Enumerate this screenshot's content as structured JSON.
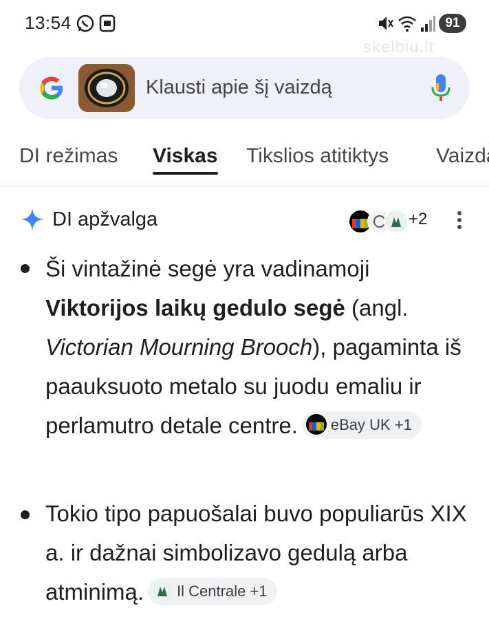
{
  "status_bar": {
    "time": "13:54",
    "battery": "91",
    "icons": [
      "whatsapp-icon",
      "screenshot-icon",
      "mute-icon",
      "wifi-icon",
      "signal-icon"
    ]
  },
  "watermark": "skelbiu.lt",
  "search": {
    "placeholder": "Klausti apie šį vaizdą",
    "icons": [
      "google-logo",
      "image-thumbnail",
      "mic-icon"
    ]
  },
  "tabs": [
    {
      "label": "DI režimas",
      "active": false
    },
    {
      "label": "Viskas",
      "active": true
    },
    {
      "label": "Tikslios atitiktys",
      "active": false
    },
    {
      "label": "Vaizdai",
      "active": false
    }
  ],
  "ai_overview": {
    "title": "DI apžvalga",
    "sources_more": "+2"
  },
  "bullets": [
    {
      "text_1": "Ši vintažinė segė yra vadinamoji ",
      "bold": "Viktorijos laikų gedulo segė",
      "text_2": " (angl. ",
      "italic": "Victorian Mourning Brooch",
      "text_3": "), pagaminta iš paauksuoto metalo su juodu emaliu ir perlamutro detale centre.",
      "chip": "eBay UK +1"
    },
    {
      "text_1": "Tokio tipo papuošalai buvo populiarūs XIX a. ir dažnai simbolizavo gedulą arba atminimą.",
      "chip": "Il Centrale +1"
    }
  ],
  "colors": {
    "accent_blue": "#4285f4",
    "search_bg": "#eef1f7",
    "chip_bg": "#f0f1f4"
  }
}
